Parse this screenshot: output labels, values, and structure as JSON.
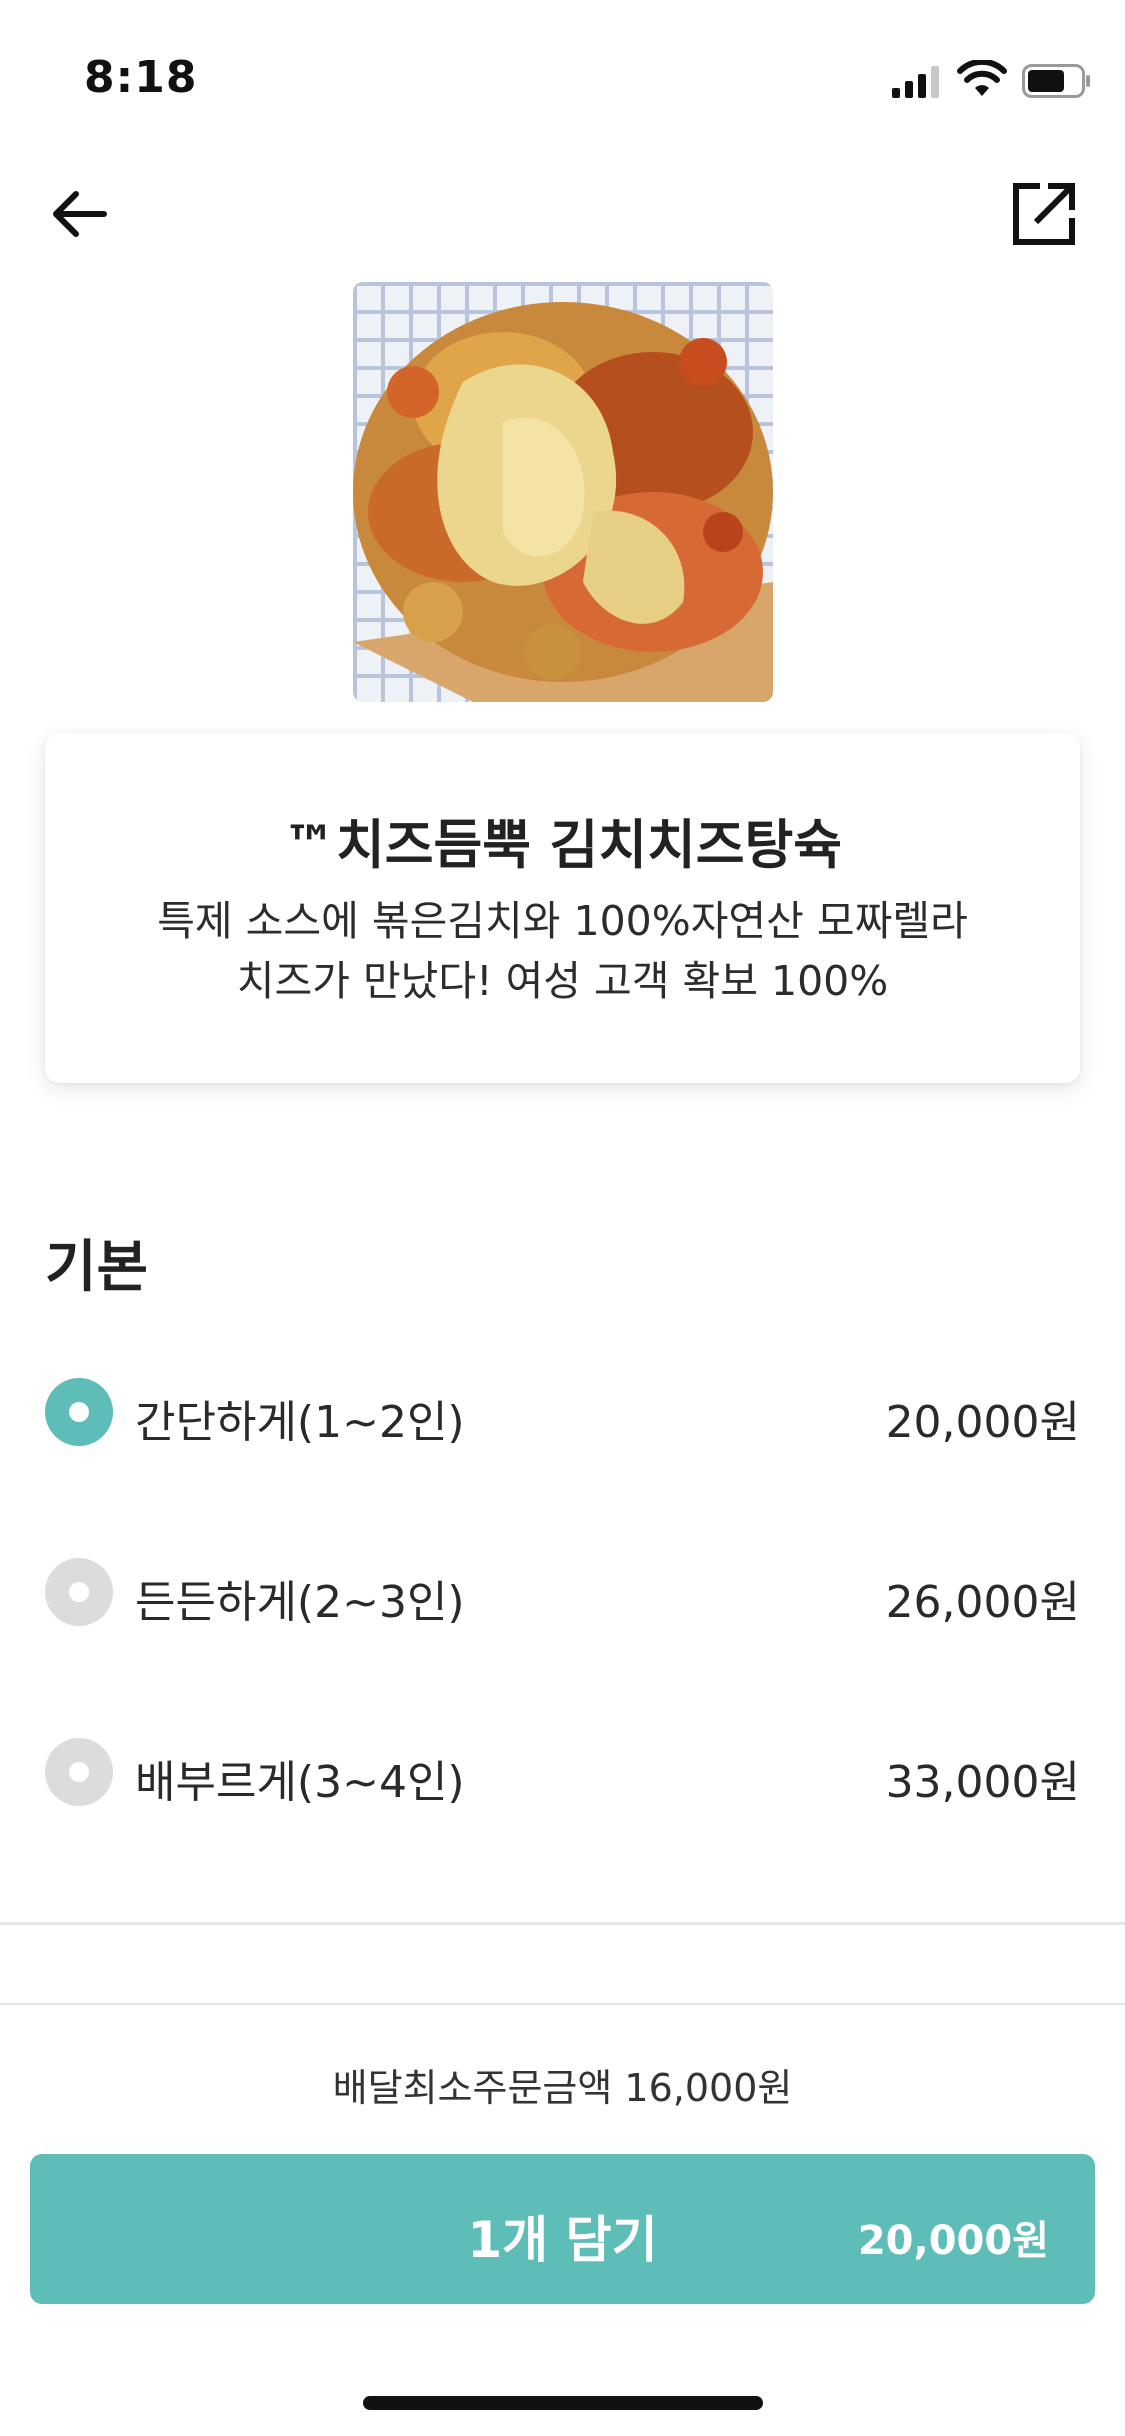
{
  "status_bar": {
    "time": "8:18",
    "icons": [
      "cellular-signal-icon",
      "wifi-icon",
      "battery-icon"
    ]
  },
  "nav": {
    "back_icon": "arrow-left-icon",
    "share_icon": "external-share-icon"
  },
  "product": {
    "image": "food-photo",
    "title": "™치즈듬뿍 김치치즈탕슉",
    "description_line1": "특제 소스에 볶은김치와 100%자연산 모짜렐라",
    "description_line2": "치즈가 만났다! 여성 고객 확보 100%"
  },
  "options": {
    "section_title": "기본",
    "items": [
      {
        "label": "간단하게(1~2인)",
        "price": "20,000원",
        "selected": true
      },
      {
        "label": "든든하게(2~3인)",
        "price": "26,000원",
        "selected": false
      },
      {
        "label": "배부르게(3~4인)",
        "price": "33,000원",
        "selected": false
      }
    ]
  },
  "footer": {
    "min_order": "배달최소주문금액 16,000원",
    "add_button_label": "1개 담기",
    "add_button_price": "20,000원"
  },
  "colors": {
    "accent": "#5fbdb8",
    "radio_off": "#dcdcdc",
    "text": "#222222"
  }
}
